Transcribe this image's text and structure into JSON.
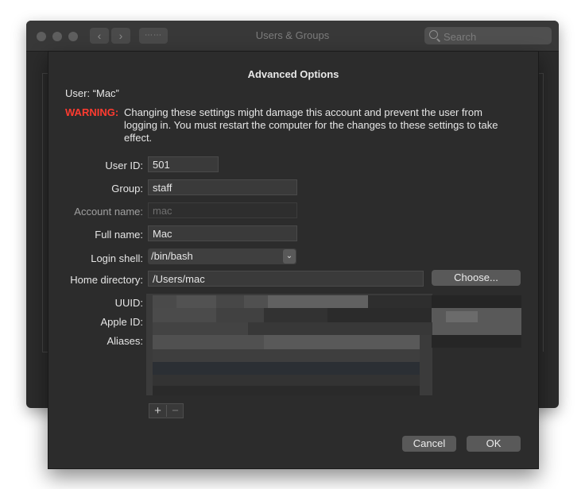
{
  "window": {
    "title": "Users & Groups",
    "search_placeholder": "Search",
    "nav_back": "‹",
    "nav_forward": "›",
    "grid_glyph": "⋯⋯"
  },
  "sheet": {
    "title": "Advanced Options",
    "user_line": "User:  “Mac”",
    "warning_label": "WARNING:",
    "warning_text": "Changing these settings might damage this account and prevent the user from logging in. You must restart the computer for the changes to these settings to take effect.",
    "fields": {
      "user_id": {
        "label": "User ID:",
        "value": "501"
      },
      "group": {
        "label": "Group:",
        "value": "staff"
      },
      "account_name": {
        "label": "Account name:",
        "value": "mac"
      },
      "full_name": {
        "label": "Full name:",
        "value": "Mac"
      },
      "login_shell": {
        "label": "Login shell:",
        "value": "/bin/bash"
      },
      "home_directory": {
        "label": "Home directory:",
        "value": "/Users/mac"
      },
      "uuid": {
        "label": "UUID:"
      },
      "apple_id": {
        "label": "Apple ID:"
      },
      "aliases": {
        "label": "Aliases:"
      }
    },
    "choose_button": "Choose...",
    "add_glyph": "+",
    "remove_glyph": "−",
    "popup_arrows": "⌄",
    "cancel_button": "Cancel",
    "ok_button": "OK"
  },
  "colors": {
    "warning": "#ff3b30",
    "sheet_bg": "#2c2c2c",
    "window_bg": "#2b2b2b"
  }
}
